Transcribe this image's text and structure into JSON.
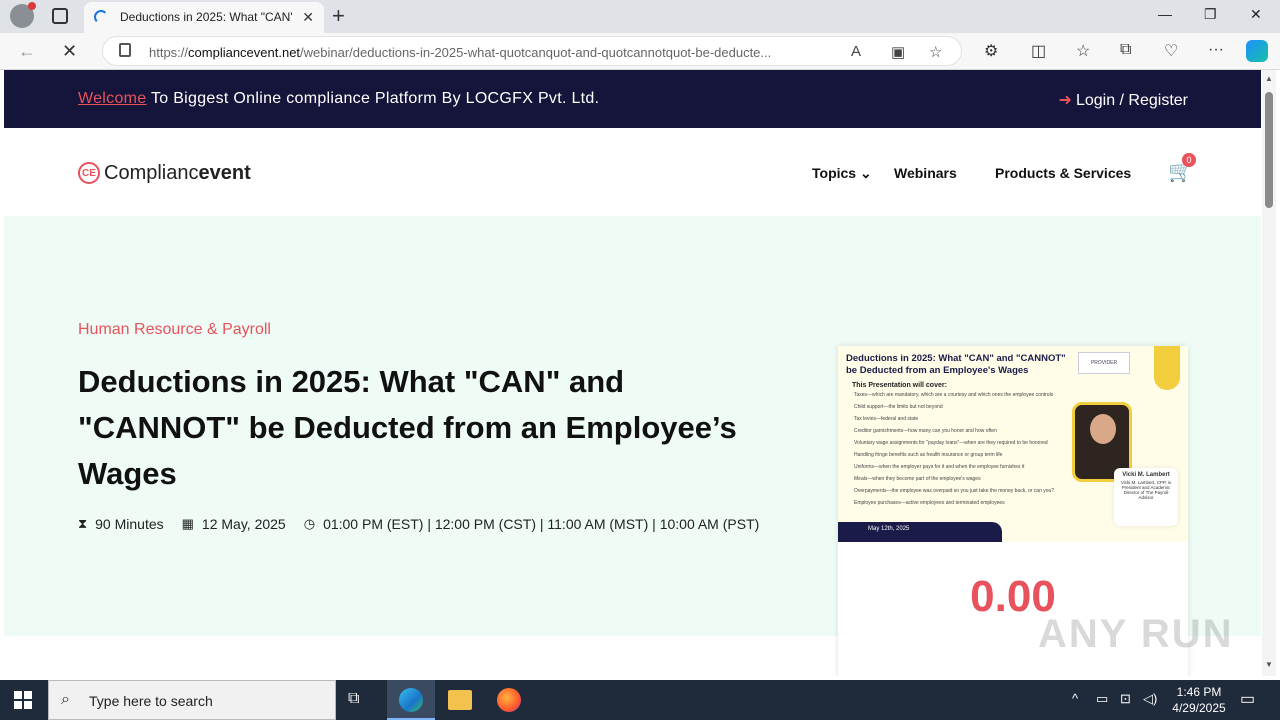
{
  "browser": {
    "tab_title": "Deductions in 2025: What \"CAN\"",
    "url_prefix": "https://",
    "url_domain": "compliancevent.net",
    "url_path": "/webinar/deductions-in-2025-what-quotcanquot-and-quotcannotquot-be-deducte..."
  },
  "topstrip": {
    "welcome_highlight": "Welcome",
    "welcome_rest": " To Biggest Online compliance Platform By LOCGFX Pvt. Ltd.",
    "login": "Login / Register"
  },
  "header": {
    "logo_part1": "Complianc",
    "logo_part2": "event",
    "logo_mark": "CE",
    "menu": [
      "Topics",
      "Webinars",
      "Products & Services"
    ],
    "cart_count": "0"
  },
  "hero": {
    "category": "Human Resource & Payroll",
    "headline": "Deductions in 2025: What \"CAN\" and \"CANNOT\" be Deducted from an Employee’s Wages",
    "duration": "90 Minutes",
    "date": "12 May, 2025",
    "time": "01:00 PM (EST) | 12:00 PM (CST) | 11:00 AM (MST) | 10:00 AM (PST)"
  },
  "card": {
    "poster_title": "Deductions in 2025: What \"CAN\" and \"CANNOT\" be Deducted from an Employee's Wages",
    "poster_cover": "This Presentation will cover:",
    "poster_items": [
      "Taxes—which are mandatory, which are a courtesy and which ones the employee controls",
      "Child support—the limits but not beyond",
      "Tax levies—federal and state",
      "Creditor garnishments—how many can you honor and how often",
      "Voluntary wage assignments for \"payday loans\"—when are they required to be honored",
      "Handling fringe benefits such as health insurance or group term life",
      "Uniforms—when the employer pays for it and when the employee furnishes it",
      "Meals—when they become part of the employee's wages",
      "Overpayments—the employee was overpaid so you just take the money back, or can you?",
      "Employee purchases—active employees and terminated employees"
    ],
    "poster_speaker_name": "Vicki M. Lambert",
    "poster_speaker_bio": "Vicki M. Lambert, CPP, is President and Academic Director of The Payroll Advisor",
    "poster_date": "May 12th, 2025",
    "poster_logos": "PROVIDER",
    "price": "0.00"
  },
  "watermark": "ANY RUN",
  "taskbar": {
    "search_placeholder": "Type here to search",
    "time": "1:46 PM",
    "date": "4/29/2025"
  }
}
